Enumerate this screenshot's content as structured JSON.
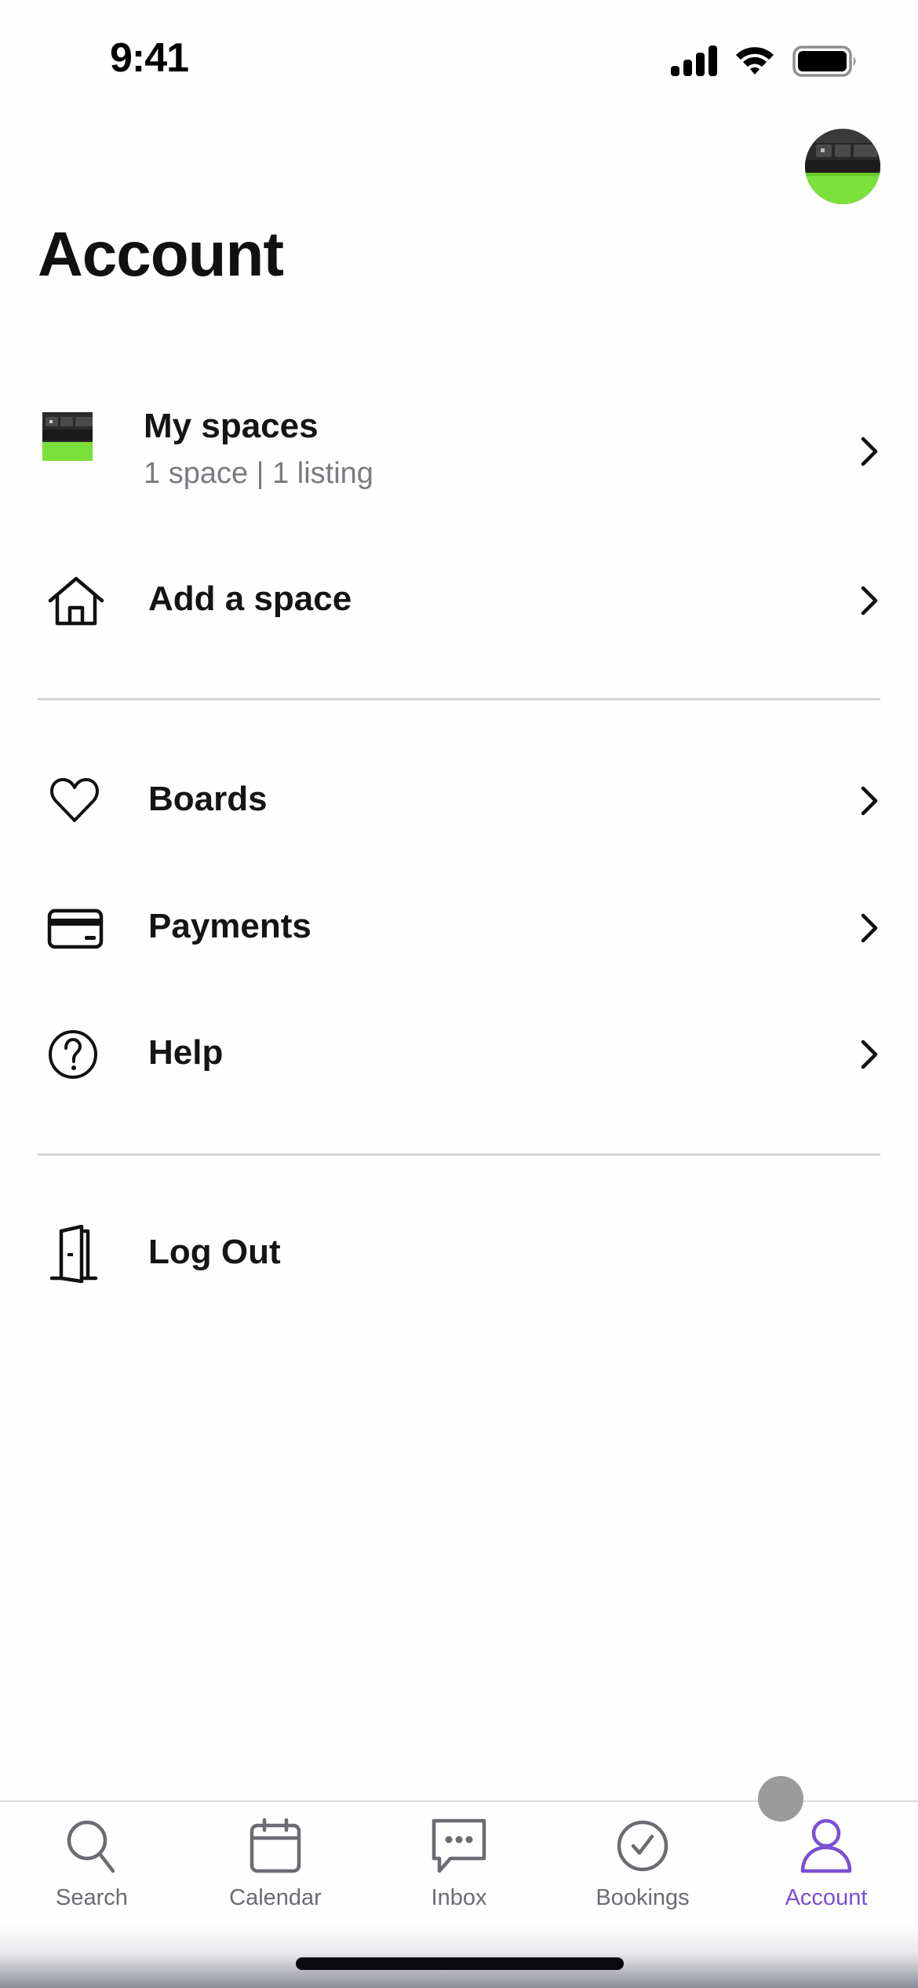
{
  "status_bar": {
    "time": "9:41",
    "icons": [
      "cellular-signal-icon",
      "wifi-icon",
      "battery-icon"
    ]
  },
  "header": {
    "title": "Account",
    "avatar": "profile-avatar"
  },
  "menu": {
    "group1": [
      {
        "id": "my-spaces",
        "label": "My spaces",
        "subtitle": "1 space | 1 listing",
        "icon": "space-thumbnail",
        "chevron": true
      },
      {
        "id": "add-space",
        "label": "Add a space",
        "icon": "home-icon",
        "chevron": true
      }
    ],
    "group2": [
      {
        "id": "boards",
        "label": "Boards",
        "icon": "heart-icon",
        "chevron": true
      },
      {
        "id": "payments",
        "label": "Payments",
        "icon": "credit-card-icon",
        "chevron": true
      },
      {
        "id": "help",
        "label": "Help",
        "icon": "help-circle-icon",
        "chevron": true
      }
    ],
    "group3": [
      {
        "id": "log-out",
        "label": "Log Out",
        "icon": "door-icon",
        "chevron": false
      }
    ]
  },
  "tabbar": {
    "active": "Account",
    "accent_color": "#7a4fd6",
    "inactive_color": "#6b6b72",
    "tabs": [
      {
        "label": "Search",
        "icon": "search-icon"
      },
      {
        "label": "Calendar",
        "icon": "calendar-icon"
      },
      {
        "label": "Inbox",
        "icon": "chat-bubble-icon"
      },
      {
        "label": "Bookings",
        "icon": "check-circle-icon"
      },
      {
        "label": "Account",
        "icon": "person-icon"
      }
    ]
  }
}
